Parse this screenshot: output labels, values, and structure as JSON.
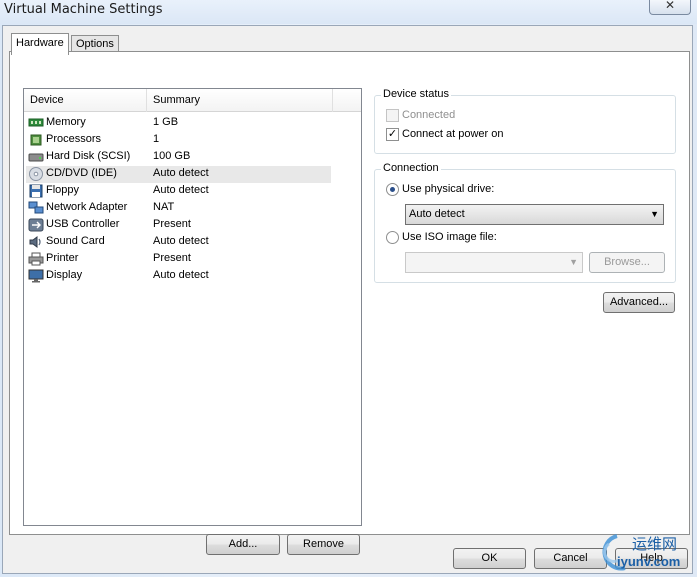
{
  "window": {
    "title": "Virtual Machine Settings",
    "close_glyph": "✕"
  },
  "tabs": [
    {
      "label": "Hardware",
      "active": true
    },
    {
      "label": "Options",
      "active": false
    }
  ],
  "device_list": {
    "columns": [
      "Device",
      "Summary"
    ],
    "rows": [
      {
        "device": "Memory",
        "summary": "1 GB",
        "icon": "memory-icon"
      },
      {
        "device": "Processors",
        "summary": "1",
        "icon": "processor-icon"
      },
      {
        "device": "Hard Disk (SCSI)",
        "summary": "100 GB",
        "icon": "hard-disk-icon"
      },
      {
        "device": "CD/DVD (IDE)",
        "summary": "Auto detect",
        "icon": "cd-dvd-icon",
        "selected": true
      },
      {
        "device": "Floppy",
        "summary": "Auto detect",
        "icon": "floppy-icon"
      },
      {
        "device": "Network Adapter",
        "summary": "NAT",
        "icon": "network-adapter-icon"
      },
      {
        "device": "USB Controller",
        "summary": "Present",
        "icon": "usb-icon"
      },
      {
        "device": "Sound Card",
        "summary": "Auto detect",
        "icon": "sound-card-icon"
      },
      {
        "device": "Printer",
        "summary": "Present",
        "icon": "printer-icon"
      },
      {
        "device": "Display",
        "summary": "Auto detect",
        "icon": "display-icon"
      }
    ],
    "add_label": "Add...",
    "remove_label": "Remove"
  },
  "device_status": {
    "title": "Device status",
    "connected_label": "Connected",
    "connected_checked": false,
    "connected_enabled": false,
    "connect_at_power_on_label": "Connect at power on",
    "connect_at_power_on_checked": true
  },
  "connection": {
    "title": "Connection",
    "physical_drive_label": "Use physical drive:",
    "physical_drive_selected": true,
    "physical_drive_value": "Auto detect",
    "iso_label": "Use ISO image file:",
    "iso_selected": false,
    "iso_value": "",
    "browse_label": "Browse..."
  },
  "advanced_label": "Advanced...",
  "footer": {
    "ok_label": "OK",
    "cancel_label": "Cancel",
    "help_label": "Help"
  },
  "watermark": {
    "text_cn": "运维网",
    "text_en": "iyunv.com"
  }
}
